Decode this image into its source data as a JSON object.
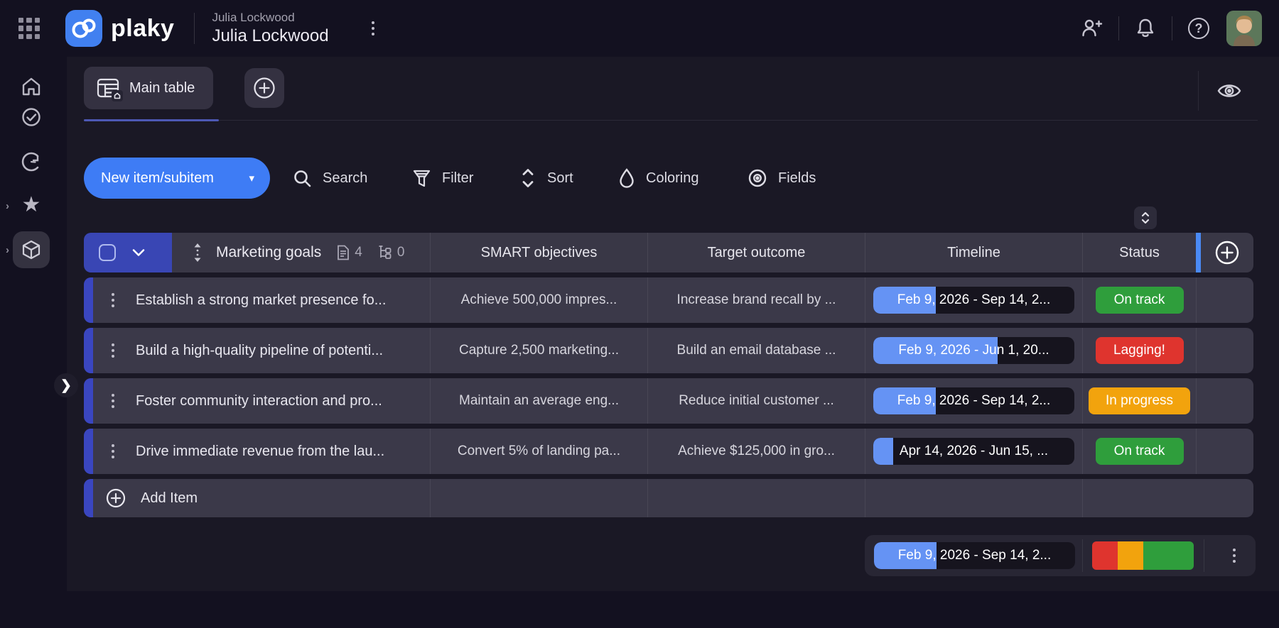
{
  "topbar": {
    "logo_text": "plaky",
    "workspace_label": "Julia Lockwood",
    "board_title": "Julia Lockwood"
  },
  "icons": {
    "question_mark": "?",
    "star_glyph": "★",
    "sidebar_chevron": "›",
    "expand_chevron": "❯",
    "caret_down": "▾"
  },
  "tabs": {
    "main_table_label": "Main table"
  },
  "toolbar": {
    "new_item_label": "New item/subitem",
    "search_label": "Search",
    "filter_label": "Filter",
    "sort_label": "Sort",
    "coloring_label": "Coloring",
    "fields_label": "Fields"
  },
  "table": {
    "group_title": "Marketing goals",
    "item_count": "4",
    "subitem_count": "0",
    "columns": {
      "objectives": "SMART objectives",
      "outcome": "Target outcome",
      "timeline": "Timeline",
      "status": "Status"
    },
    "rows": [
      {
        "name": "Establish a strong market presence fo...",
        "objective": "Achieve 500,000 impres...",
        "outcome": "Increase brand recall by ...",
        "timeline": "Feb 9, 2026 - Sep 14, 2...",
        "timeline_fill": "31%",
        "status": "On track",
        "status_color": "#2f9e3c"
      },
      {
        "name": "Build a high-quality pipeline of potenti...",
        "objective": "Capture 2,500 marketing...",
        "outcome": "Build an email database ...",
        "timeline": "Feb 9, 2026 - Jun 1, 20...",
        "timeline_fill": "62%",
        "status": "Lagging!",
        "status_color": "#df342e"
      },
      {
        "name": "Foster community interaction and pro...",
        "objective": "Maintain an average eng...",
        "outcome": "Reduce initial customer ...",
        "timeline": "Feb 9, 2026 - Sep 14, 2...",
        "timeline_fill": "31%",
        "status": "In progress",
        "status_color": "#f2a30d"
      },
      {
        "name": "Drive immediate revenue from the lau...",
        "objective": "Convert 5% of landing pa...",
        "outcome": "Achieve $125,000 in gro...",
        "timeline": "Apr 14, 2026 - Jun 15, ...",
        "timeline_fill": "10%",
        "status": "On track",
        "status_color": "#2f9e3c"
      }
    ],
    "add_item_label": "Add Item",
    "summary": {
      "timeline_text": "Feb 9, 2026 - Sep 14, 2...",
      "timeline_fill": "31%",
      "segments": [
        {
          "color": "#df342e",
          "width": "25%"
        },
        {
          "color": "#f2a30d",
          "width": "25%"
        },
        {
          "color": "#2f9e3c",
          "width": "50%"
        }
      ]
    }
  },
  "colors": {
    "accent_blue": "#3e7cf5",
    "timeline_fill_blue": "#6593f4",
    "header_blue": "#3946b4",
    "row_accent_blue": "#3a46c0"
  }
}
